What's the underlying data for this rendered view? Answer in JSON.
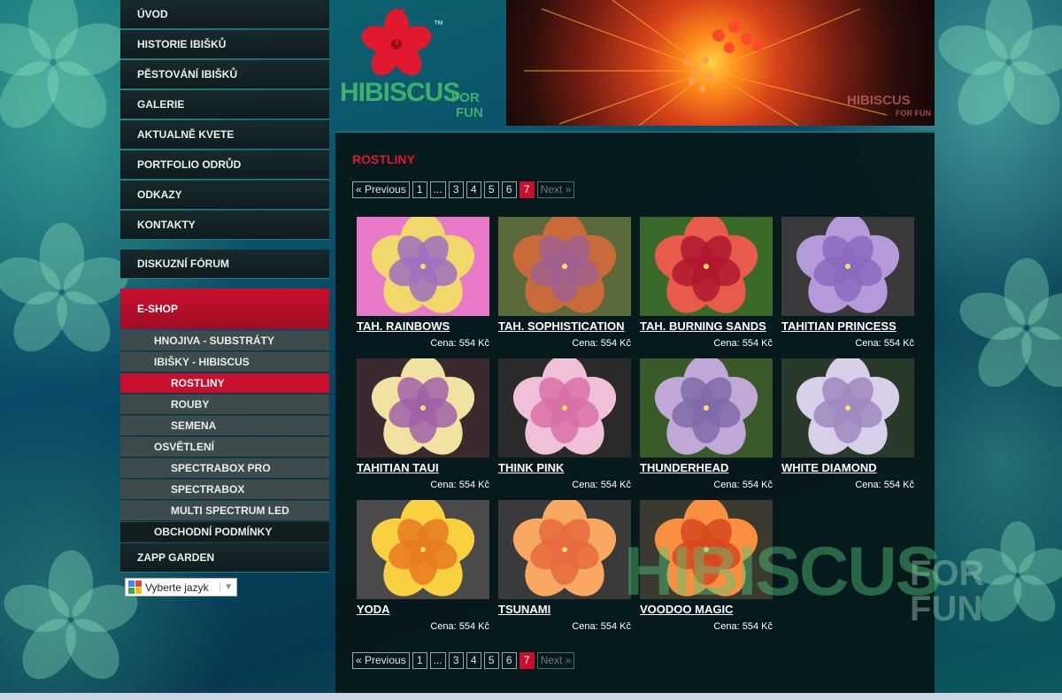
{
  "nav": {
    "main": [
      "ÚVOD",
      "HISTORIE IBIŠKŮ",
      "PĚSTOVÁNÍ IBIŠKŮ",
      "GALERIE",
      "AKTUALNĚ KVETE",
      "PORTFOLIO ODRŮD",
      "ODKAZY",
      "KONTAKTY"
    ],
    "forum": "DISKUZNÍ FÓRUM",
    "eshop": "E-SHOP",
    "eshop_items": [
      {
        "label": "HNOJIVA - SUBSTRÁTY",
        "level": 1
      },
      {
        "label": "IBIŠKY - HIBISCUS",
        "level": 1
      },
      {
        "label": "ROSTLINY",
        "level": 2,
        "active": true
      },
      {
        "label": "ROUBY",
        "level": 2
      },
      {
        "label": "SEMENA",
        "level": 2
      },
      {
        "label": "OSVĚTLENÍ",
        "level": 1
      },
      {
        "label": "SPECTRABOX PRO",
        "level": 2
      },
      {
        "label": "SPECTRABOX",
        "level": 2
      },
      {
        "label": "MULTI SPECTRUM LED",
        "level": 2
      },
      {
        "label": "OBCHODNÍ PODMÍNKY",
        "level": 1,
        "dark": true
      }
    ],
    "zapp": "ZAPP GARDEN"
  },
  "language": {
    "label": "Vyberte jazyk",
    "icon": "google-translate-icon"
  },
  "logo": {
    "main": "HIBISCUS",
    "for": "FOR",
    "fun": "FUN",
    "tm": "™"
  },
  "banner": {
    "watermark_main": "HIBISCUS",
    "watermark_sub": "FOR FUN"
  },
  "page_title": "ROSTLINY",
  "pagination": {
    "prev": "« Previous",
    "items": [
      "1",
      "...",
      "3",
      "4",
      "5",
      "6",
      "7"
    ],
    "current": "7",
    "next": "Next »"
  },
  "products": [
    {
      "name": "TAH. RAINBOWS",
      "price": "Cena: 554 Kč",
      "c1": "#f2d86a",
      "c2": "#a070c0",
      "c3": "#e878c8"
    },
    {
      "name": "TAH. SOPHISTICATION",
      "price": "Cena: 554 Kč",
      "c1": "#c96a3a",
      "c2": "#a06090",
      "c3": "#5a6a3a"
    },
    {
      "name": "TAH. BURNING SANDS",
      "price": "Cena: 554 Kč",
      "c1": "#e85a4a",
      "c2": "#b01830",
      "c3": "#3a6a2a"
    },
    {
      "name": "TAHITIAN PRINCESS",
      "price": "Cena: 554 Kč",
      "c1": "#b49ad8",
      "c2": "#8a6ac0",
      "c3": "#3a3a3a"
    },
    {
      "name": "TAHITIAN TAUI",
      "price": "Cena: 554 Kč",
      "c1": "#f0e2a0",
      "c2": "#a060a8",
      "c3": "#3a2a30"
    },
    {
      "name": "THINK PINK",
      "price": "Cena: 554 Kč",
      "c1": "#f0c0d8",
      "c2": "#d870a8",
      "c3": "#2a2a2a"
    },
    {
      "name": "THUNDERHEAD",
      "price": "Cena: 554 Kč",
      "c1": "#c0a8d8",
      "c2": "#806aa8",
      "c3": "#3a5a2a"
    },
    {
      "name": "WHITE DIAMOND",
      "price": "Cena: 554 Kč",
      "c1": "#d8d0e8",
      "c2": "#a088c0",
      "c3": "#2a3a2a"
    },
    {
      "name": "YODA",
      "price": "Cena: 554 Kč",
      "c1": "#f8d040",
      "c2": "#e87a20",
      "c3": "#4a4a4a"
    },
    {
      "name": "TSUNAMI",
      "price": "Cena: 554 Kč",
      "c1": "#f8a860",
      "c2": "#e86a40",
      "c3": "#3a3a3a"
    },
    {
      "name": "VOODOO MAGIC",
      "price": "Cena: 554 Kč",
      "c1": "#f89040",
      "c2": "#d84820",
      "c3": "#3a3a30"
    }
  ],
  "watermark": {
    "main": "HIBISCUS",
    "for": "FOR",
    "fun": "FUN"
  },
  "colors": {
    "accent": "#c8102e",
    "nav_bg": "#0f1c1f",
    "teal": "#0d6a74"
  }
}
